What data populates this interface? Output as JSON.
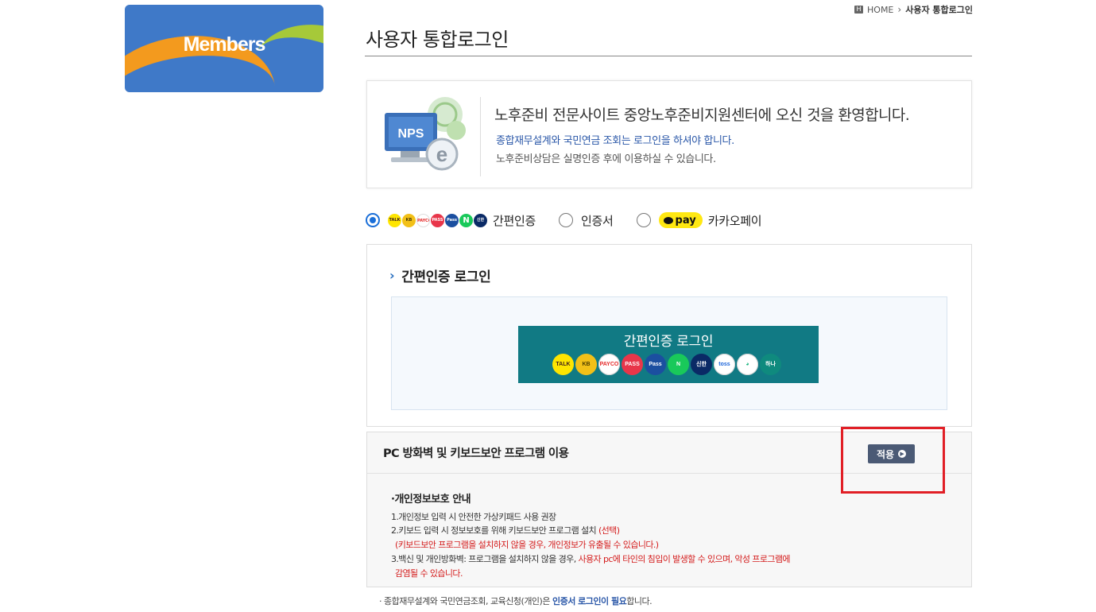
{
  "banner": {
    "title": "Members"
  },
  "breadcrumb": {
    "home": "HOME",
    "current": "사용자 통합로그인"
  },
  "page": {
    "title": "사용자 통합로그인"
  },
  "welcome": {
    "logo_text": "NPS",
    "heading": "노후준비 전문사이트 중앙노후준비지원센터에 오신 것을 환영합니다.",
    "line1": "종합재무설계와 국민연금 조회는 로그인을 하셔야 합니다.",
    "line2": "노후준비상담은 실명인증 후에 이용하실 수 있습니다."
  },
  "auth_methods": {
    "simple": {
      "label": "간편인증",
      "checked": true
    },
    "certificate": {
      "label": "인증서",
      "checked": false
    },
    "kakaopay": {
      "badge": "pay",
      "label": "카카오페이",
      "checked": false
    },
    "mini_icons": [
      "TALK",
      "KB",
      "PAYCO",
      "PASS",
      "Pass",
      "N",
      "신한"
    ]
  },
  "simple_login": {
    "section_title": "간편인증 로그인",
    "button_label": "간편인증 로그인",
    "providers": [
      {
        "name": "kakao-talk",
        "text": "TALK",
        "bg": "#fee500",
        "fg": "#3c1e1e"
      },
      {
        "name": "kb",
        "text": "KB",
        "bg": "#f2c018",
        "fg": "#4a3b00"
      },
      {
        "name": "payco",
        "text": "PAYCO",
        "bg": "#ffffff",
        "fg": "#e52a2a"
      },
      {
        "name": "pass",
        "text": "PASS",
        "bg": "#e8364a",
        "fg": "#ffffff"
      },
      {
        "name": "samsung-pass",
        "text": "Pass",
        "bg": "#1b4fa0",
        "fg": "#ffffff"
      },
      {
        "name": "naver",
        "text": "N",
        "bg": "#19c95a",
        "fg": "#ffffff"
      },
      {
        "name": "shinhan",
        "text": "신한",
        "bg": "#0a2a66",
        "fg": "#ffffff"
      },
      {
        "name": "toss",
        "text": "toss",
        "bg": "#ffffff",
        "fg": "#1b64da"
      },
      {
        "name": "banksalad",
        "text": "◕",
        "bg": "#ffffff",
        "fg": "#18b37d"
      },
      {
        "name": "hana",
        "text": "하나",
        "bg": "#0f8a7e",
        "fg": "#ffffff"
      }
    ]
  },
  "security": {
    "title": "PC 방화벽 및 키보드보안 프로그램 이용",
    "apply_label": "적용",
    "privacy_title": "·개인정보보호 안내",
    "item1": "1.개인정보 입력 시 안전한 가상키패드 사용 권장",
    "item2": "2.키보드 입력 시 정보보호를 위해 키보드보안 프로그램 설치",
    "item2_red": "(선택)",
    "item2_note": "(키보드보안 프로그램을 설치하지 않을 경우, 개인정보가 유출될 수 있습니다.)",
    "item3": "3.백신 및 개인방화벽: 프로그램을 설치하지 않을 경우,",
    "item3_red": "사용자 pc에 타인의 침입이 발생할 수 있으며, 악성 프로그램에",
    "item3_red2": "감염될 수 있습니다."
  },
  "footnote": {
    "prefix": "· 종합재무설계와 국민연금조회, 교육신청(개인)은",
    "bold": "인증서 로그인이 필요",
    "suffix": "합니다."
  },
  "colors": {
    "accent": "#117a84",
    "highlight": "#e11f26",
    "banner": "#3f79c8"
  }
}
